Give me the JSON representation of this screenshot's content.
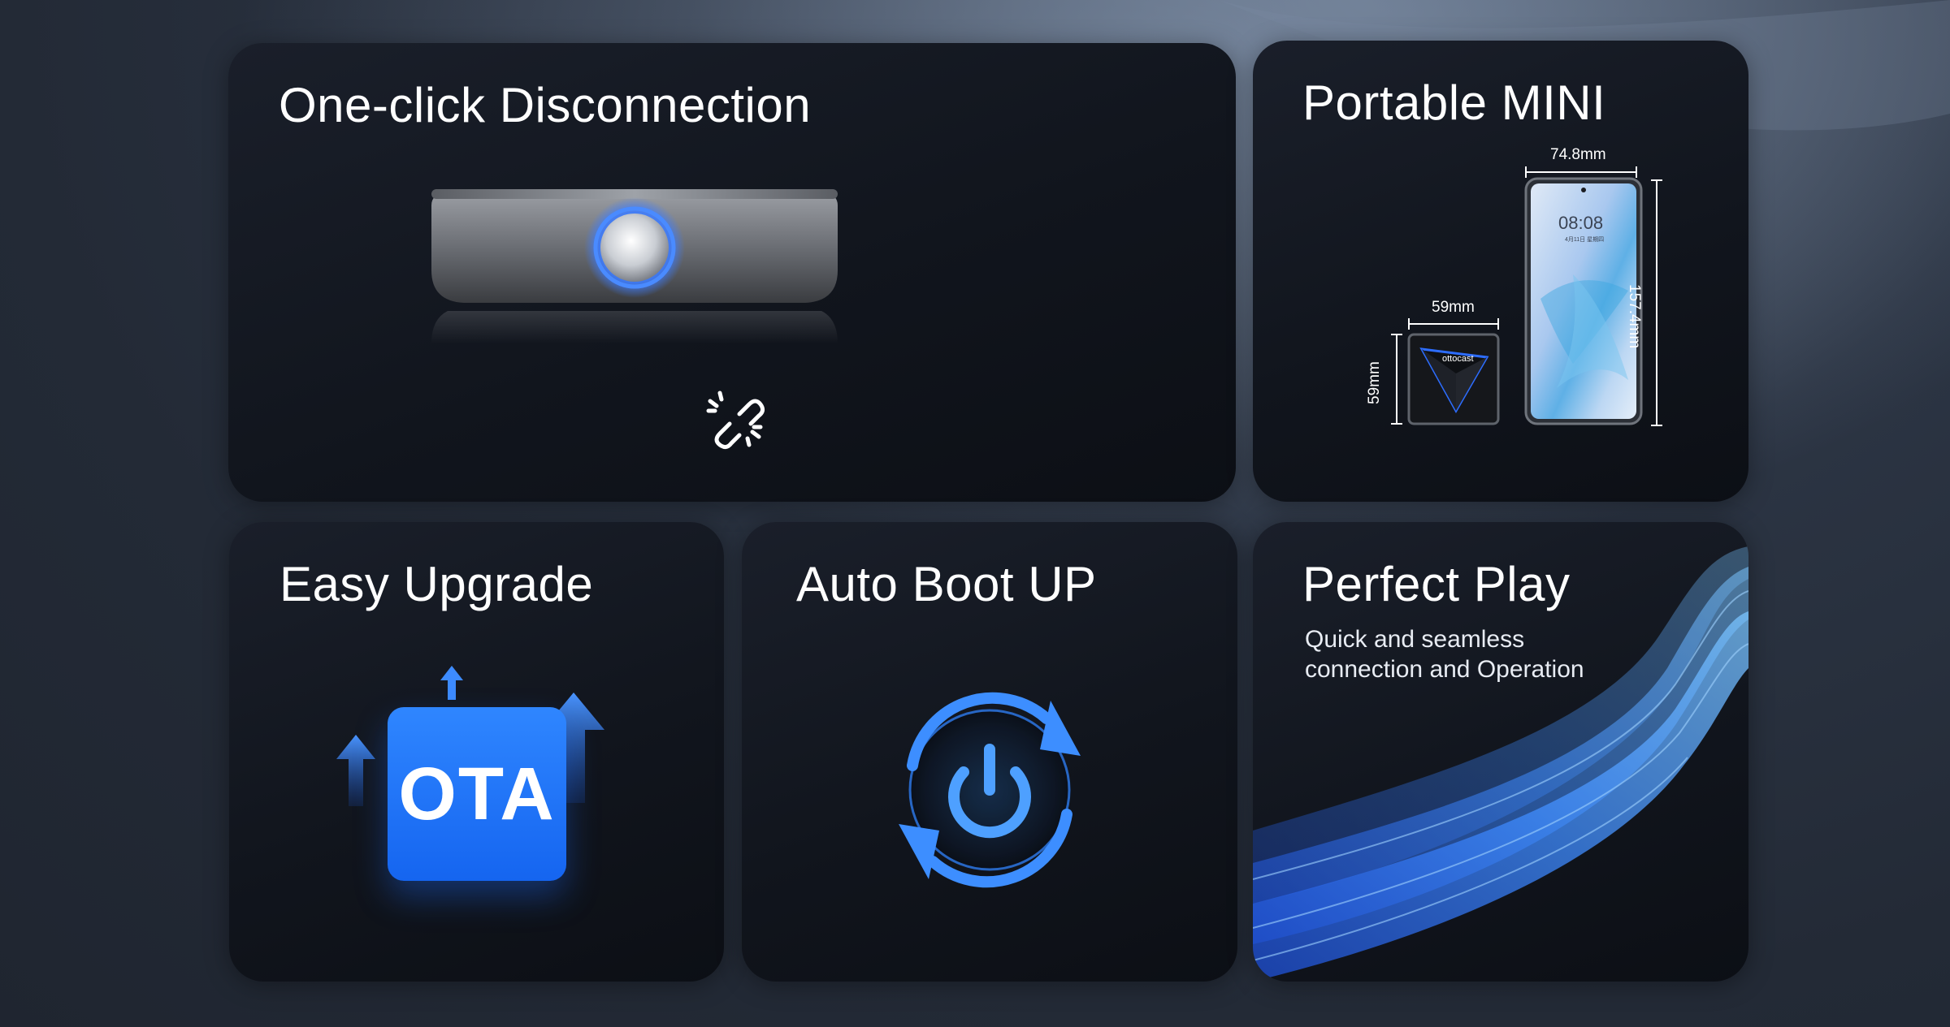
{
  "features": {
    "disconnect": {
      "title": "One-click Disconnection",
      "icon": "broken-link-icon"
    },
    "mini": {
      "title": "Portable MINI",
      "phone_width": "74.8mm",
      "phone_height": "157.4mm",
      "box_width": "59mm",
      "box_height": "59mm",
      "phone_time": "08:08",
      "phone_date": "4月11日 星期四",
      "brand": "ottocast"
    },
    "upgrade": {
      "title": "Easy Upgrade",
      "badge": "OTA"
    },
    "boot": {
      "title": "Auto Boot UP",
      "icon": "power-icon"
    },
    "play": {
      "title": "Perfect Play",
      "subtitle_line1": "Quick and seamless",
      "subtitle_line2": "connection and Operation"
    }
  },
  "colors": {
    "accent_blue": "#2f7bff",
    "card_bg": "#12161e",
    "page_bg": "#252c38"
  }
}
